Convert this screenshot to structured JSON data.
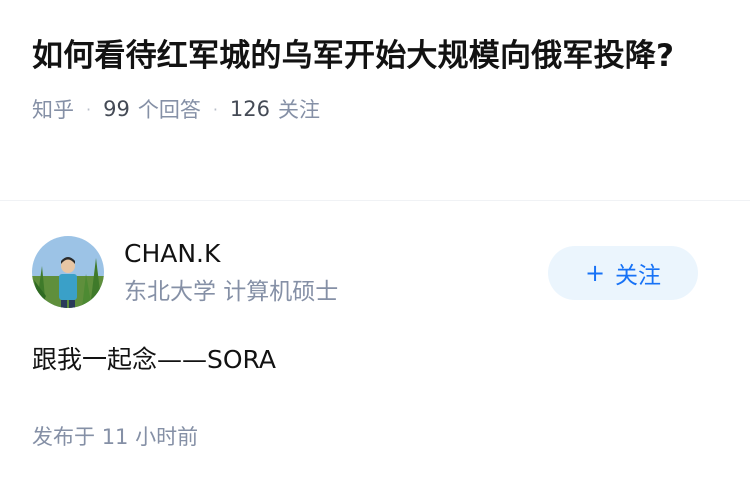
{
  "question": {
    "title": "如何看待红军城的乌军开始大规模向俄军投降?",
    "source": "知乎",
    "answer_count": "99",
    "answer_count_label": "个回答",
    "follower_count": "126",
    "follower_count_label": "关注"
  },
  "author": {
    "name": "CHAN.K",
    "headline": "东北大学 计算机硕士",
    "follow_plus": "+",
    "follow_label": "关注"
  },
  "answer": {
    "content": "跟我一起念——SORA",
    "published_label": "发布于",
    "published_time": "11 小时前"
  },
  "colors": {
    "accent": "#1772f6",
    "follow_bg": "#ebf5fd",
    "meta": "#8590a6"
  }
}
